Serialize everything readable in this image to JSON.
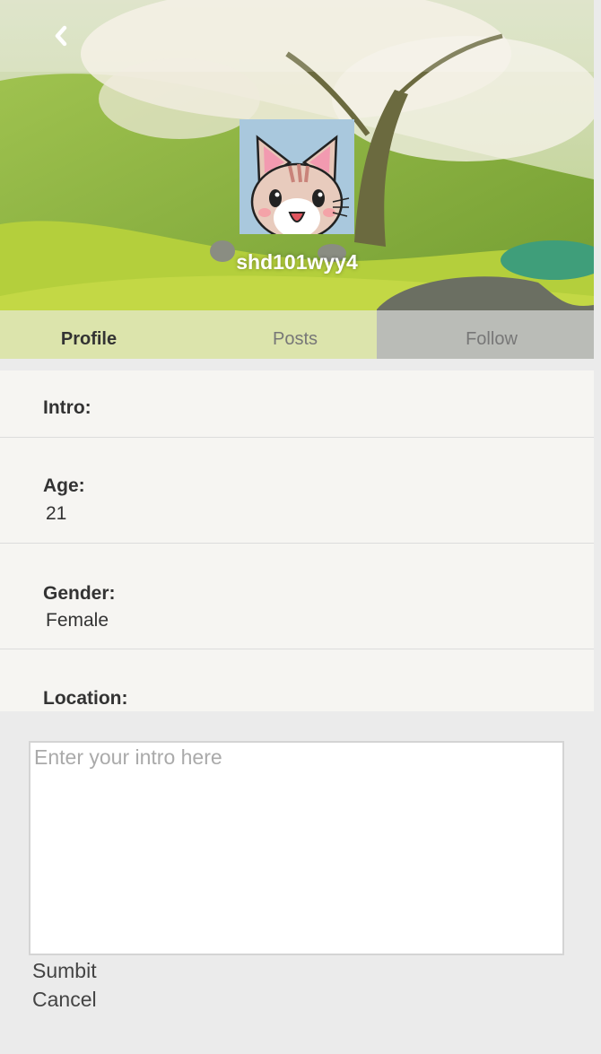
{
  "header": {
    "back_icon": "chevron-left-icon",
    "username": "shd101wyy4",
    "avatar_icon": "cat-avatar-icon"
  },
  "tabs": [
    {
      "label": "Profile",
      "active": true
    },
    {
      "label": "Posts",
      "active": false
    },
    {
      "label": "Follow",
      "active": false
    }
  ],
  "profile": {
    "intro_label": "Intro:",
    "age_label": "Age:",
    "age_value": "21",
    "gender_label": "Gender:",
    "gender_value": "Female",
    "location_label": "Location:"
  },
  "edit": {
    "intro_placeholder": "Enter your intro here",
    "submit_label": "Sumbit",
    "cancel_label": "Cancel"
  },
  "colors": {
    "info_background": "#f6f5f2",
    "edit_background": "#ebebeb",
    "avatar_background": "#a9c8dd"
  }
}
